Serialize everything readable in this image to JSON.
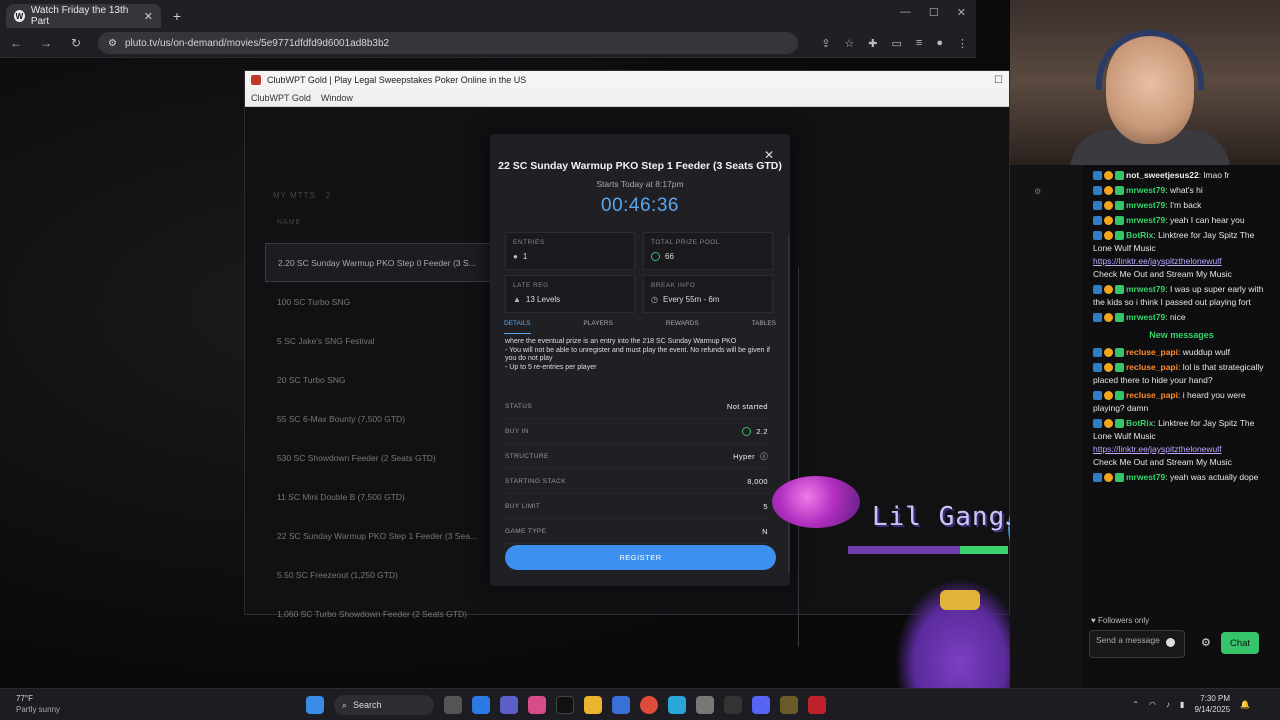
{
  "browser": {
    "tab_title": "Watch Friday the 13th Part",
    "url": "pluto.tv/us/on-demand/movies/5e9771dfdfd9d6001ad8b3b2"
  },
  "app": {
    "window_title": "ClubWPT Gold | Play Legal Sweepstakes Poker Online in the US",
    "menu": [
      "ClubWPT Gold",
      "Window"
    ]
  },
  "lobby": {
    "section_title": "MY MTTS",
    "section_count": "2",
    "name_header": "NAME",
    "tournaments": [
      {
        "name": "2.20 SC Sunday Warmup PKO Step 0 Feeder (3 S..."
      },
      {
        "name": "100 SC Turbo SNG"
      },
      {
        "name": "5 SC Jake's SNG Festival"
      },
      {
        "name": "20 SC Turbo SNG"
      },
      {
        "name": "55 SC 6-Max Bounty (7,500 GTD)"
      },
      {
        "name": "530 SC Showdown Feeder (2 Seats GTD)"
      },
      {
        "name": "11 SC Mini Double B (7,500 GTD)"
      },
      {
        "name": "22 SC Sunday Warmup PKO Step 1 Feeder (3 Sea..."
      },
      {
        "name": "5.50 SC Freezeout (1,250 GTD)"
      },
      {
        "name": "1,060 SC Turbo Showdown Feeder (2 Seats GTD)"
      }
    ]
  },
  "modal": {
    "title": "22 SC Sunday Warmup PKO Step 1 Feeder (3 Seats GTD)",
    "starts": "Starts Today at 8:17pm",
    "timer": "00:46:36",
    "entries_label": "ENTRIES",
    "entries_value": "1",
    "prize_label": "TOTAL PRIZE POOL",
    "prize_value": "66",
    "latereg_label": "LATE REG",
    "latereg_value": "13 Levels",
    "break_label": "BREAK INFO",
    "break_value": "Every 55m - 6m",
    "tabs": [
      "DETAILS",
      "PLAYERS",
      "REWARDS",
      "TABLES"
    ],
    "desc_lines": [
      "where the eventual prize is an entry into the 218 SC Sunday Warmup PKO",
      "- You will not be able to unregister and must play the event. No refunds will be given if you do not play",
      "- Up to 5 re-entries per player"
    ],
    "rows": [
      {
        "label": "STATUS",
        "value": "Not started"
      },
      {
        "label": "BUY IN",
        "value": "2.2"
      },
      {
        "label": "STRUCTURE",
        "value": "Hyper"
      },
      {
        "label": "STARTING STACK",
        "value": "8,000"
      },
      {
        "label": "BUY LIMIT",
        "value": "5"
      },
      {
        "label": "GAME TYPE",
        "value": "N"
      }
    ],
    "register_label": "REGISTER"
  },
  "overlay": {
    "title": "Lil GangJ"
  },
  "chat": {
    "messages": [
      {
        "user": "not_sweetjesus22",
        "text": "lmao fr",
        "color": "white"
      },
      {
        "user": "mrwest79",
        "text": "what's hi",
        "color": "green"
      },
      {
        "user": "mrwest79",
        "text": "I'm back",
        "color": "green"
      },
      {
        "user": "mrwest79",
        "text": "yeah I can hear you",
        "color": "green"
      },
      {
        "user": "BotRix",
        "text": "Linktree for Jay Spitz The Lone Wulf Music",
        "link": "https://linktr.ee/jayspitzthelonewulf",
        "after": "Check Me Out and Stream My Music",
        "color": "green"
      },
      {
        "user": "mrwest79",
        "text": "I was up super early with the kids so i think I passed out playing fort",
        "color": "green"
      },
      {
        "user": "mrwest79",
        "text": "nice",
        "color": "green"
      }
    ],
    "new_messages": "New messages",
    "messages2": [
      {
        "user": "recluse_papi",
        "text": "wuddup wulf",
        "color": "orange"
      },
      {
        "user": "recluse_papi",
        "text": "lol is that strategically placed there to hide your hand?",
        "color": "orange"
      },
      {
        "user": "recluse_papi",
        "text": "i heard you were playing? damn",
        "color": "orange"
      },
      {
        "user": "BotRix",
        "text": "Linktree for Jay Spitz The Lone Wulf Music",
        "link": "https://linktr.ee/jayspitzthelonewulf",
        "after": "Check Me Out and Stream My Music",
        "color": "green"
      },
      {
        "user": "mrwest79",
        "text": "yeah was actually dope",
        "color": "green"
      }
    ],
    "followers_only": "Followers only",
    "send_placeholder": "Send a message",
    "chat_button": "Chat"
  },
  "taskbar": {
    "temp": "77°F",
    "weather": "Partly sunny",
    "search": "Search",
    "time": "7:30 PM",
    "date": "9/14/2025"
  },
  "colors": {
    "accent_blue": "#3d8ff0",
    "timer_blue": "#58a6f0",
    "twitch_green": "#35c46a",
    "coin_green": "#3fb86b"
  }
}
